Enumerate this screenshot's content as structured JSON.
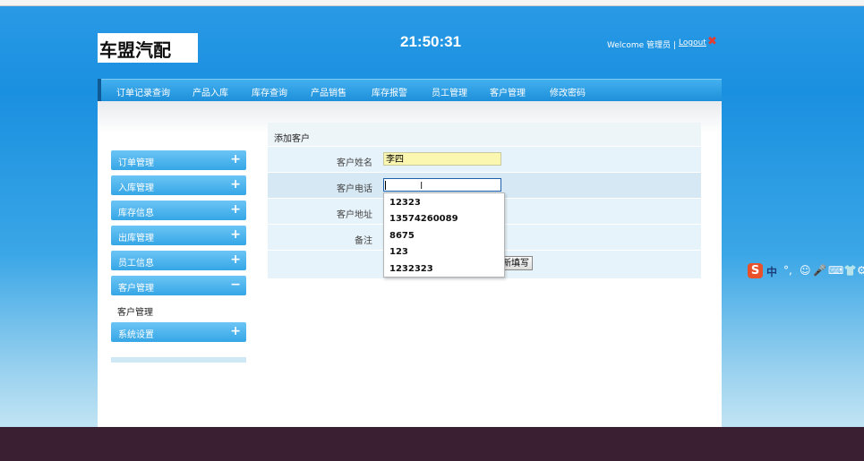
{
  "header": {
    "logo_text": "车盟汽配",
    "clock": "21:50:31",
    "welcome": "Welcome 管理员 |",
    "logout_label": "Logout",
    "logout_icon": "✖"
  },
  "nav": {
    "items": [
      "订单记录查询",
      "产品入库",
      "库存查询",
      "产品销售",
      "库存报警",
      "员工管理",
      "客户管理",
      "修改密码"
    ]
  },
  "sidebar": {
    "items": [
      {
        "label": "订单管理",
        "toggle": "+"
      },
      {
        "label": "入库管理",
        "toggle": "+"
      },
      {
        "label": "库存信息",
        "toggle": "+"
      },
      {
        "label": "出库管理",
        "toggle": "+"
      },
      {
        "label": "员工信息",
        "toggle": "+"
      },
      {
        "label": "客户管理",
        "toggle": "−"
      },
      {
        "label": "系统设置",
        "toggle": "+"
      }
    ],
    "subitem": "客户管理"
  },
  "form": {
    "title": "添加客户",
    "name_label": "客户姓名",
    "name_value": "李四",
    "phone_label": "客户电话",
    "phone_value": "",
    "address_label": "客户地址",
    "note_label": "备注",
    "reset_button": "新填写"
  },
  "autocomplete": {
    "options": [
      "12323",
      "13574260089",
      "8675",
      "123",
      "1232323"
    ]
  },
  "ime": {
    "s_logo": "S",
    "zh": "中",
    "punct": "°,",
    "symbols": [
      "☺",
      "🎤",
      "⌨",
      "👕",
      "⚙"
    ]
  },
  "colors": {
    "nav_blue": "#1c8ed9",
    "sidebar_blue": "#35a6e6",
    "logout_red": "#e63b2e",
    "highlight_yellow": "#fbf6b0"
  }
}
